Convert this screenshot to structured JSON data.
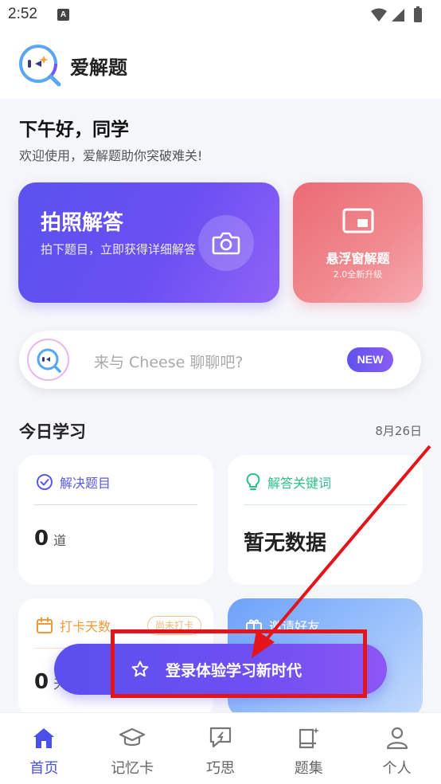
{
  "status_bar": {
    "time": "2:52",
    "notification_letter": "A"
  },
  "app": {
    "title": "爱解题"
  },
  "greeting": {
    "title": "下午好，同学",
    "subtitle": "欢迎使用，爱解题助你突破难关!"
  },
  "photo_card": {
    "title": "拍照解答",
    "description": "拍下题目，立即获得详细解答"
  },
  "float_card": {
    "title": "悬浮窗解题",
    "subtitle": "2.0全新升级"
  },
  "chat": {
    "placeholder": "来与 Cheese 聊聊吧?",
    "badge": "NEW"
  },
  "today": {
    "title": "今日学习",
    "date": "8月26日",
    "solved": {
      "label": "解决题目",
      "value": "0",
      "unit": "道"
    },
    "keywords": {
      "label": "解答关键词",
      "value": "暂无数据"
    },
    "checkin": {
      "label": "打卡天数",
      "badge": "尚未打卡",
      "value": "0",
      "unit": "天"
    },
    "invite": {
      "label": "邀请好友"
    }
  },
  "login_banner": {
    "label": "登录体验学习新时代"
  },
  "bottom_nav": {
    "items": [
      {
        "label": "首页",
        "icon": "home-icon",
        "active": true
      },
      {
        "label": "记忆卡",
        "icon": "graduation-cap-icon",
        "active": false
      },
      {
        "label": "巧思",
        "icon": "chat-bolt-icon",
        "active": false
      },
      {
        "label": "题集",
        "icon": "collection-icon",
        "active": false
      },
      {
        "label": "个人",
        "icon": "person-icon",
        "active": false
      }
    ]
  },
  "colors": {
    "primary": "#5a52f0",
    "accent_red": "#e4141b",
    "float_card": "#ea6a74",
    "invite_card": "#6da2fa"
  }
}
